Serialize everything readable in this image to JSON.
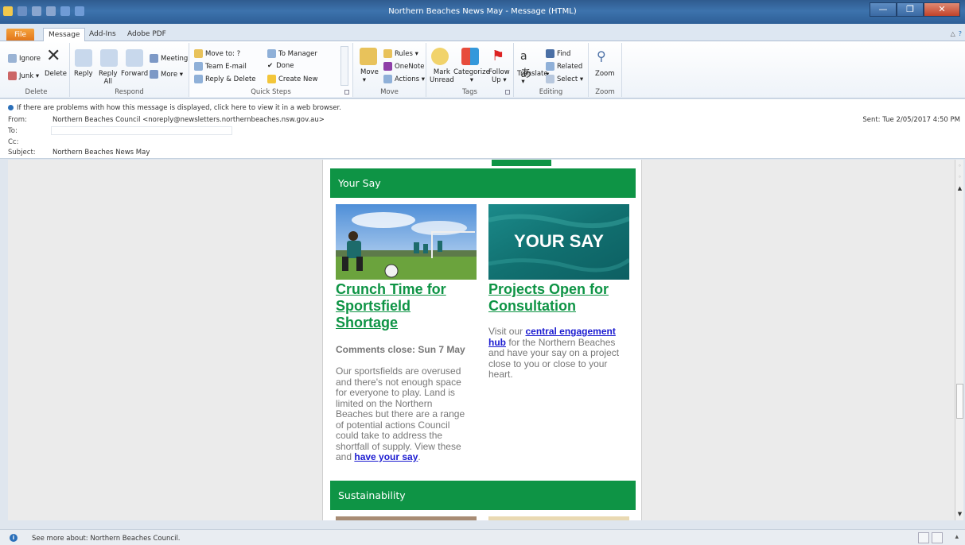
{
  "window": {
    "title": "Northern Beaches News May - Message (HTML)",
    "minimize": "—",
    "maximize": "❐",
    "close": "✕"
  },
  "tabs": [
    "File",
    "Message",
    "Add-Ins",
    "Adobe PDF"
  ],
  "ribbon": {
    "delete": {
      "label": "Delete",
      "ignore": "Ignore",
      "junk": "Junk",
      "delete": "Delete"
    },
    "respond": {
      "label": "Respond",
      "reply": "Reply",
      "reply_all_1": "Reply",
      "reply_all_2": "All",
      "forward": "Forward",
      "meeting": "Meeting",
      "more": "More"
    },
    "quicksteps": {
      "label": "Quick Steps",
      "items": [
        "Move to: ?",
        "Team E-mail",
        "Reply & Delete",
        "To Manager",
        "Done",
        "Create New"
      ]
    },
    "move": {
      "label": "Move",
      "move": "Move",
      "rules": "Rules",
      "onenote": "OneNote",
      "actions": "Actions"
    },
    "tags": {
      "label": "Tags",
      "mark_unread_1": "Mark",
      "mark_unread_2": "Unread",
      "categorize": "Categorize",
      "follow_up_1": "Follow",
      "follow_up_2": "Up"
    },
    "editing": {
      "label": "Editing",
      "translate": "Translate",
      "find": "Find",
      "related": "Related",
      "select": "Select"
    },
    "zoom": {
      "label": "Zoom",
      "zoom": "Zoom"
    }
  },
  "header": {
    "info": "If there are problems with how this message is displayed, click here to view it in a web browser.",
    "from_label": "From:",
    "from_value": "Northern Beaches Council <noreply@newsletters.northernbeaches.nsw.gov.au>",
    "to_label": "To:",
    "cc_label": "Cc:",
    "subject_label": "Subject:",
    "subject_value": "Northern Beaches News May",
    "sent": "Sent:  Tue 2/05/2017 4:50 PM"
  },
  "newsletter": {
    "section1": "Your Say",
    "section2": "Sustainability",
    "left": {
      "title": "Crunch Time for Sportsfield Shortage",
      "title_lines": [
        "Crunch Time for",
        "Sportsfield",
        "Shortage"
      ],
      "sub": "Comments close: Sun 7 May",
      "body_lines": [
        "Our sportsfields are overused",
        "and there's not enough space",
        "for everyone to play. Land is",
        "limited on the Northern",
        "Beaches but there are a range",
        "of potential actions Council",
        "could take to address the",
        "shortfall of supply. View these"
      ],
      "last_prefix": "and ",
      "link": "have your say",
      "last_suffix": "."
    },
    "right": {
      "image_text": "YOUR SAY",
      "title_lines": [
        "Projects Open for",
        "Consultation"
      ],
      "body_start": "Visit our ",
      "link_lines": [
        "central engagement",
        "hub"
      ],
      "body_lines": [
        " for the Northern Beaches",
        "and have your say on a project",
        "close to you or close to your",
        "heart."
      ]
    }
  },
  "status": {
    "text": "See more about: Northern Beaches Council."
  },
  "colors": {
    "green": "#0e9445",
    "link": "#1b1bd0",
    "titlebar": "#2f5b8f"
  }
}
